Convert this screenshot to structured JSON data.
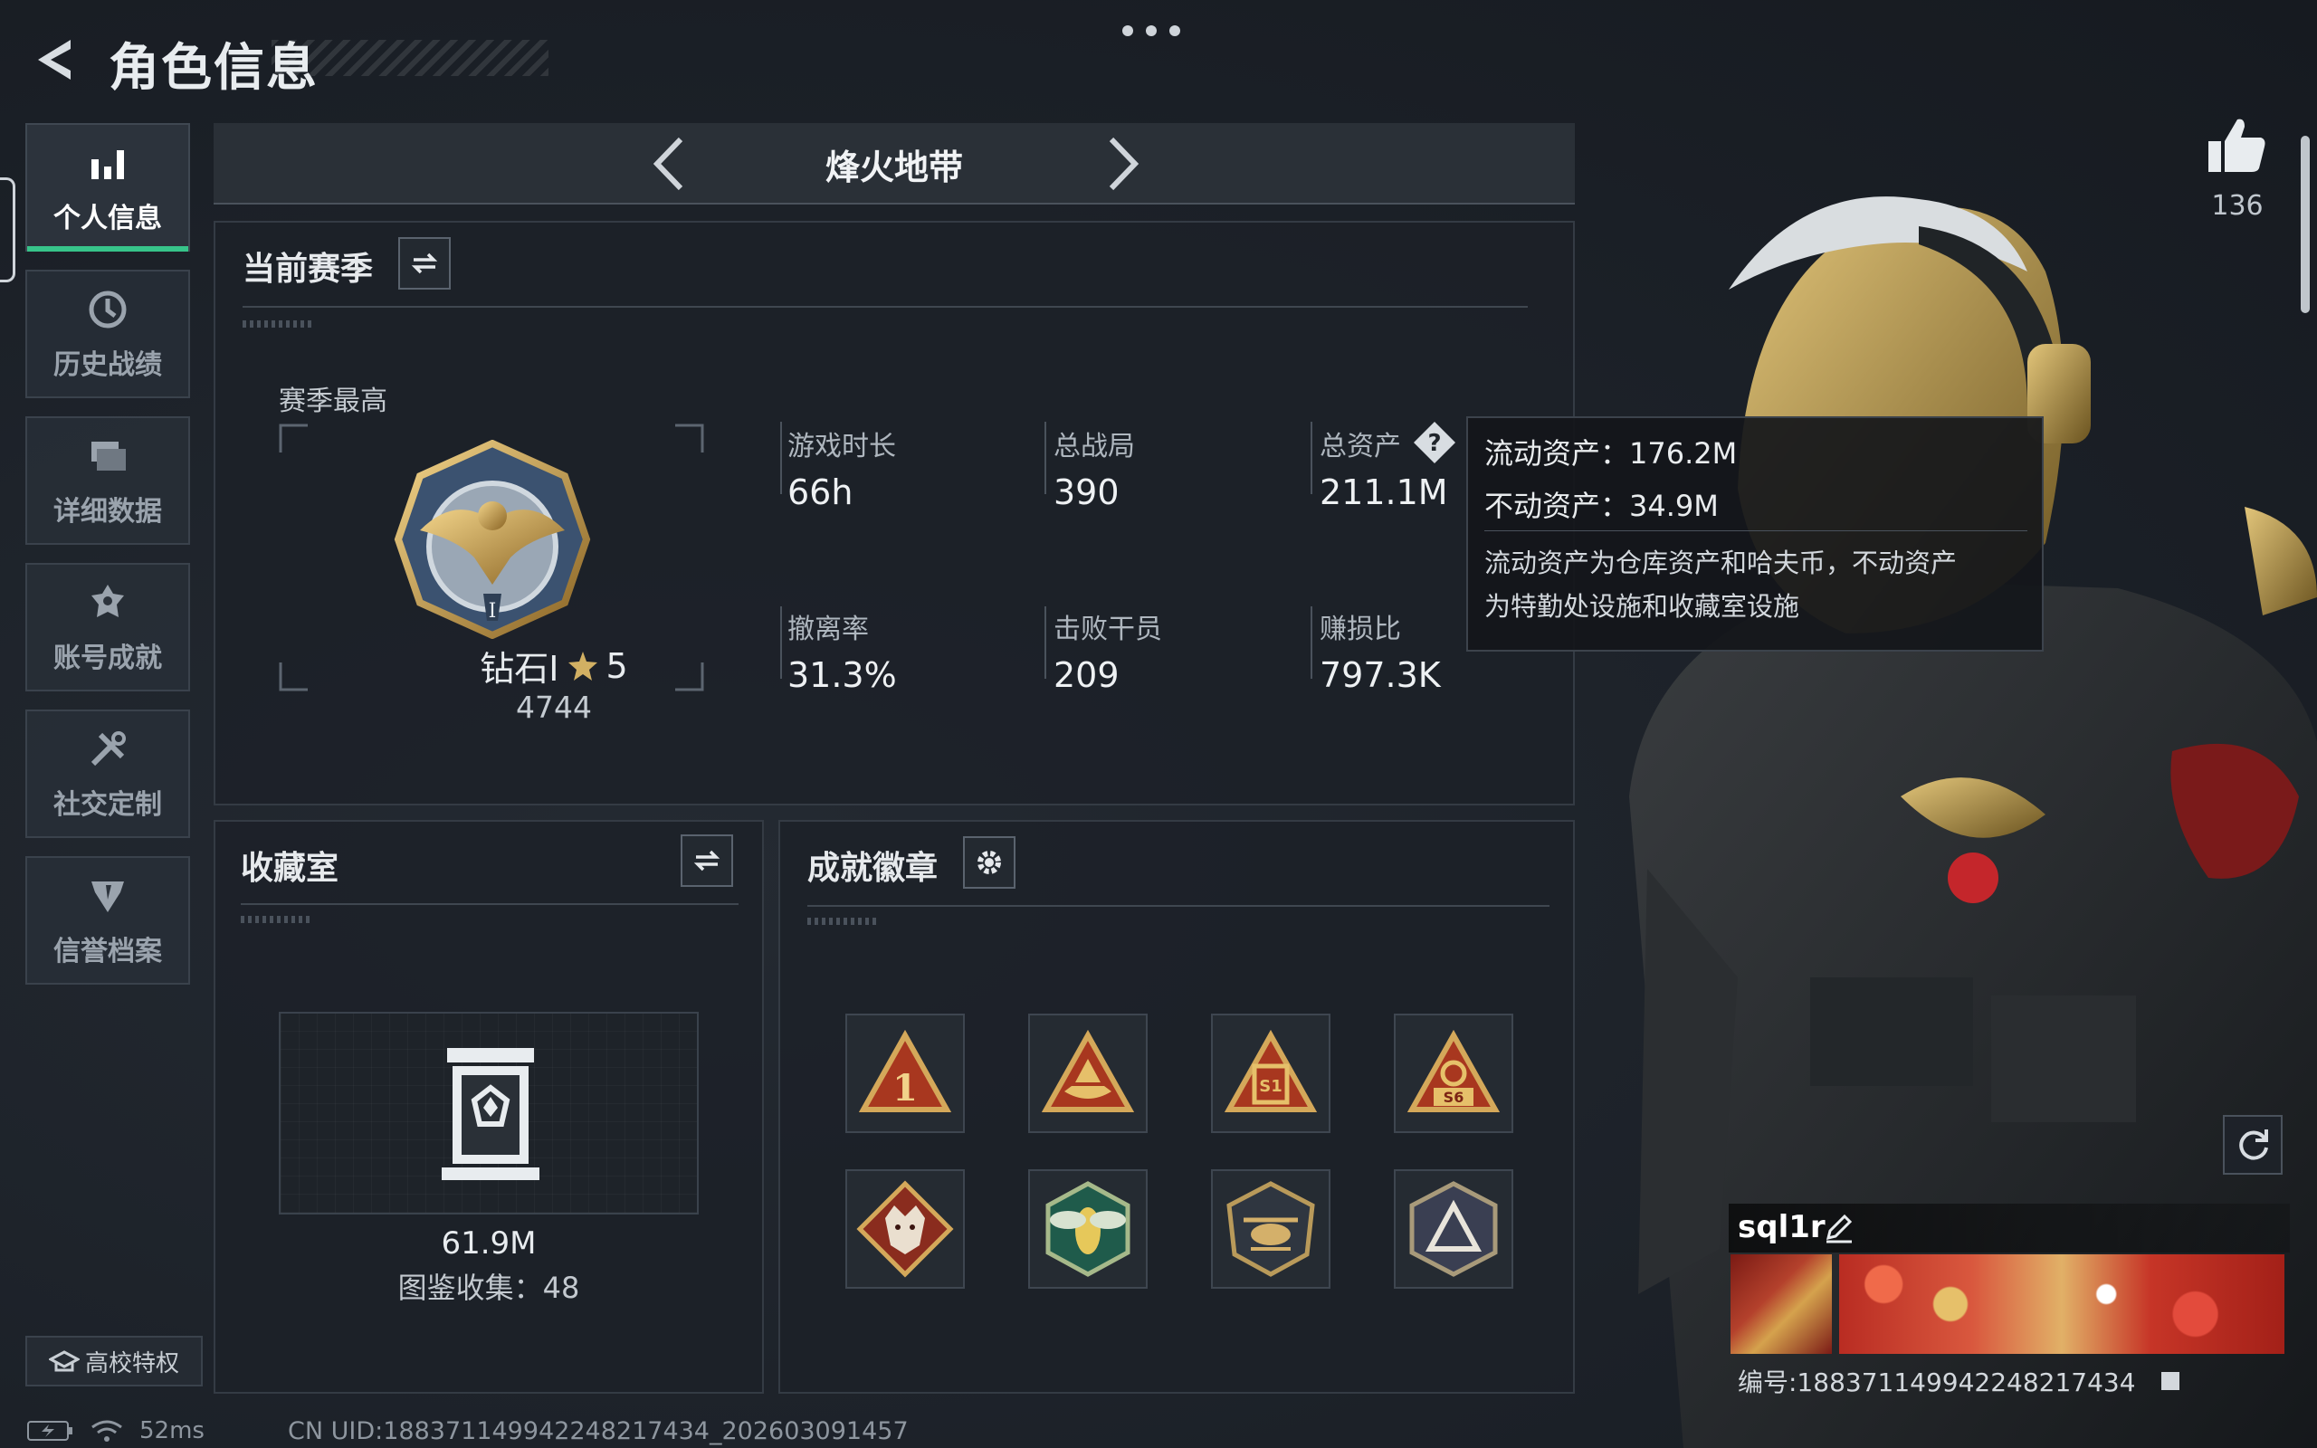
{
  "header": {
    "title": "角色信息"
  },
  "sidebar": {
    "items": [
      {
        "label": "个人信息",
        "icon": "bar-chart-icon",
        "active": true
      },
      {
        "label": "历史战绩",
        "icon": "history-icon",
        "active": false
      },
      {
        "label": "详细数据",
        "icon": "folder-icon",
        "active": false
      },
      {
        "label": "账号成就",
        "icon": "medal-icon",
        "active": false
      },
      {
        "label": "社交定制",
        "icon": "tools-icon",
        "active": false
      },
      {
        "label": "信誉档案",
        "icon": "shield-icon",
        "active": false
      }
    ],
    "campus_label": "高校特权"
  },
  "season_bar": {
    "name": "烽火地带"
  },
  "current_season": {
    "title": "当前赛季",
    "best_label": "赛季最高",
    "rank_name": "钻石Ⅰ",
    "rank_stars": "5",
    "rank_score": "4744",
    "stats": [
      {
        "label": "游戏时长",
        "value": "66h"
      },
      {
        "label": "总战局",
        "value": "390"
      },
      {
        "label": "总资产",
        "value": "211.1M"
      },
      {
        "label": "撤离率",
        "value": "31.3%"
      },
      {
        "label": "击败干员",
        "value": "209"
      },
      {
        "label": "赚损比",
        "value": "797.3K"
      }
    ]
  },
  "tooltip": {
    "liquid": "流动资产：176.2M",
    "fixed": "不动资产：34.9M",
    "desc_line1": "流动资产为仓库资产和哈夫币，不动资产",
    "desc_line2": "为特勤处设施和收藏室设施"
  },
  "collection": {
    "title": "收藏室",
    "value": "61.9M",
    "catalog": "图鉴收集：48"
  },
  "achievements": {
    "title": "成就徽章",
    "badges": [
      {
        "icon": "badge-rank-1-icon",
        "text": "1"
      },
      {
        "icon": "badge-boat-icon",
        "text": ""
      },
      {
        "icon": "badge-box-icon",
        "text": "S1"
      },
      {
        "icon": "badge-s6-icon",
        "text": "S6"
      },
      {
        "icon": "badge-wolf-icon",
        "text": ""
      },
      {
        "icon": "badge-wasp-icon",
        "text": ""
      },
      {
        "icon": "badge-helicopter-icon",
        "text": ""
      },
      {
        "icon": "badge-triangle-icon",
        "text": ""
      }
    ]
  },
  "profile": {
    "likes": "136",
    "player_name": "sql1r",
    "serial": "编号:188371149942248217434"
  },
  "status_bar": {
    "ping": "52ms",
    "uid": "CN UID:188371149942248217434_202603091457"
  },
  "colors": {
    "accent_green": "#37c48a",
    "gold": "#c9a34a",
    "background": "#1b2027"
  }
}
